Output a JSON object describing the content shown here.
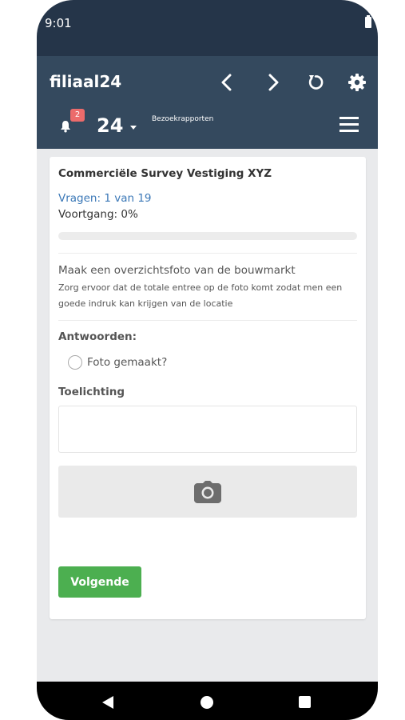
{
  "status_bar": {
    "time": "9:01"
  },
  "header": {
    "title": "filiaal24",
    "notification_count": "2",
    "visit_count": "24",
    "subtitle": "Bezoekrapporten",
    "icons": [
      "chevron-left-icon",
      "chevron-right-icon",
      "refresh-icon",
      "gear-icon",
      "bell-icon",
      "menu-icon"
    ]
  },
  "survey": {
    "title": "Commerciële Survey Vestiging XYZ",
    "questions_text": "Vragen: 1 van 19",
    "progress_text": "Voortgang: 0%",
    "progress_value": 0,
    "question": "Maak een overzichtsfoto van de bouwmarkt",
    "question_description": "Zorg ervoor dat de totale entree op de foto komt zodat men een goede indruk kan krijgen van de locatie",
    "answers_label": "Antwoorden:",
    "answer_option": "Foto gemaakt?",
    "comment_label": "Toelichting",
    "comment_value": "",
    "next_label": "Volgende"
  },
  "colors": {
    "status_bar": "#253549",
    "header": "#34495e",
    "accent_link": "#3b78b7",
    "badge": "#ec6b6b",
    "button_green": "#4caf50"
  }
}
